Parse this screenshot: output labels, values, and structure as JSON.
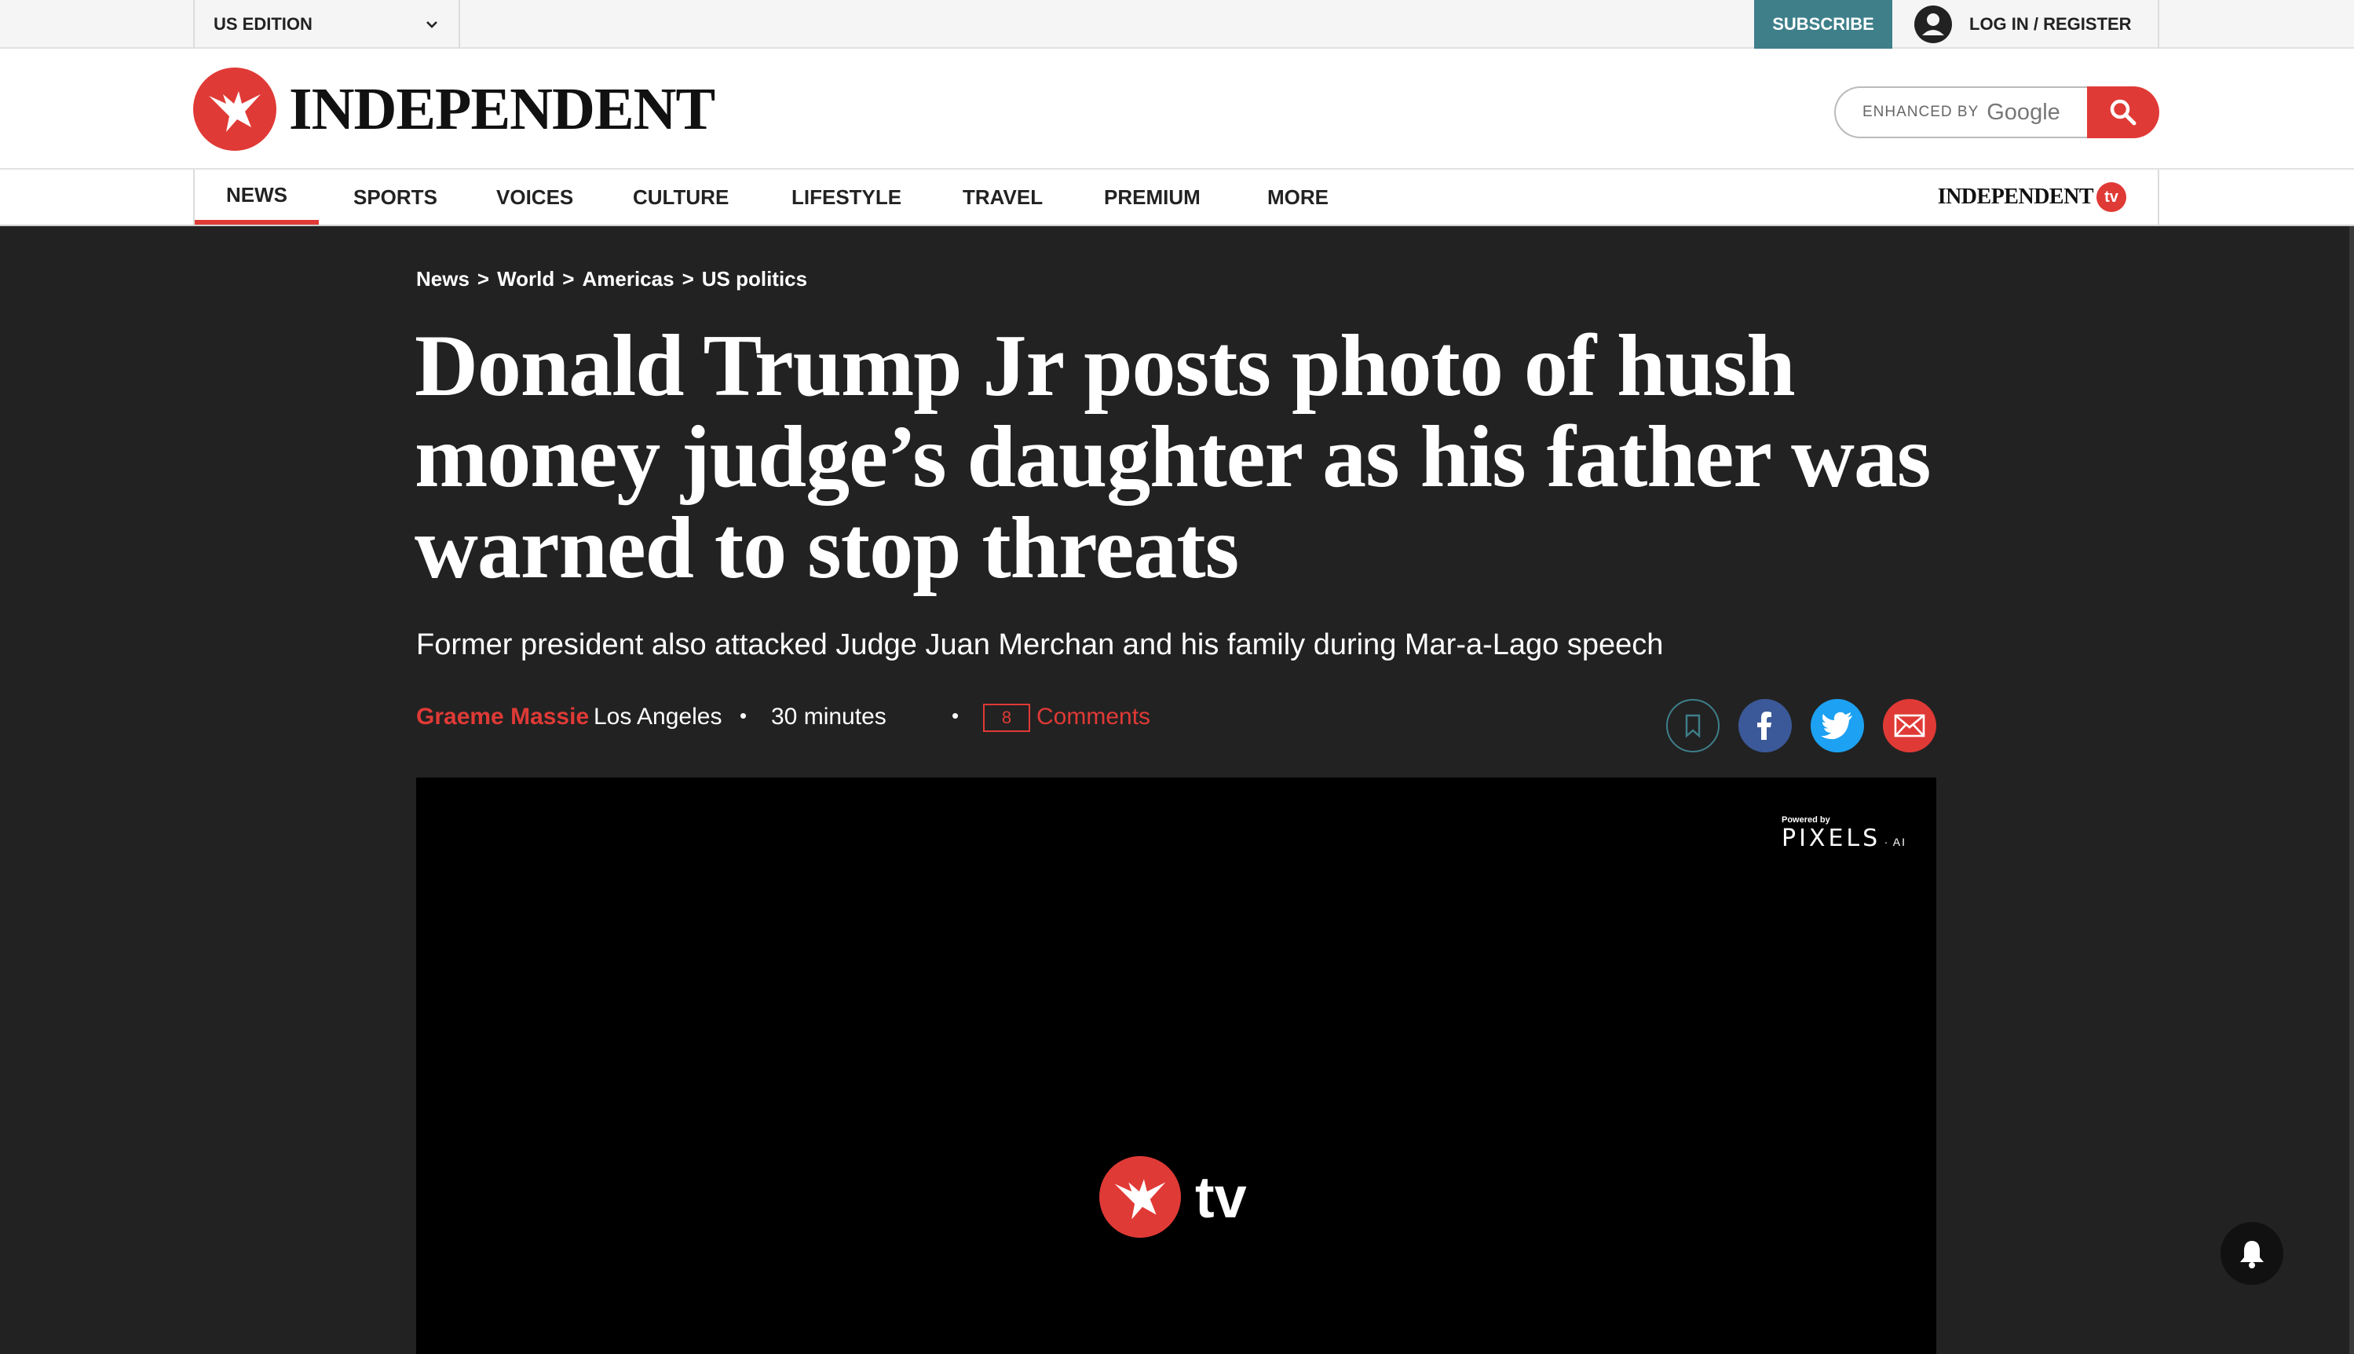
{
  "topbar": {
    "edition": "US EDITION",
    "subscribe": "SUBSCRIBE",
    "login": "LOG IN / REGISTER"
  },
  "header": {
    "logo_text": "INDEPENDENT",
    "search_enhanced": "ENHANCED BY",
    "search_google": "Google"
  },
  "nav": {
    "items": [
      "NEWS",
      "SPORTS",
      "VOICES",
      "CULTURE",
      "LIFESTYLE",
      "TRAVEL",
      "PREMIUM",
      "MORE"
    ],
    "active": "NEWS",
    "tv_brand": "INDEPENDENT",
    "tv_badge": "tv"
  },
  "breadcrumb": [
    "News",
    ">",
    "World",
    ">",
    "Americas",
    ">",
    "US politics"
  ],
  "article": {
    "headline": "Donald Trump Jr posts photo of hush money judge’s daughter as his father was warned to stop threats",
    "standfirst": "Former president also attacked Judge Juan Merchan and his family during Mar-a-Lago speech",
    "author": "Graeme Massie",
    "location": "Los Angeles",
    "time": "30 minutes",
    "comment_count": "8",
    "comments_label": "Comments"
  },
  "video": {
    "powered_by": "Powered by",
    "pixels": "PIXELS",
    "ai": "AI",
    "tv_word": "tv"
  },
  "colors": {
    "brand_red": "#e03a36",
    "subscribe_teal": "#3e7f8a",
    "facebook": "#3b5998",
    "twitter": "#1da1f2",
    "dark_bg": "#222222"
  }
}
